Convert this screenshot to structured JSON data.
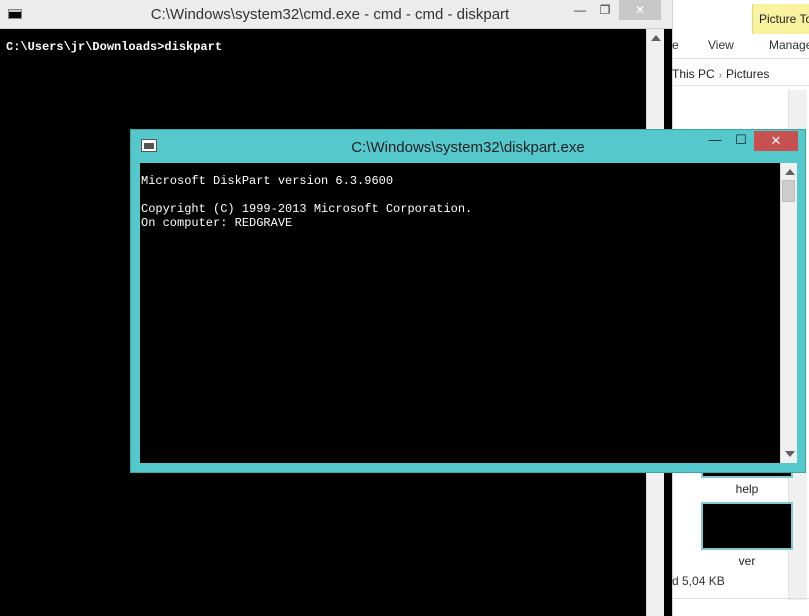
{
  "explorer": {
    "context_tab": "Picture To",
    "ribbon_tabs": [
      "e",
      "View",
      "Manage"
    ],
    "breadcrumb": [
      "This PC",
      "Pictures"
    ],
    "thumbnails": [
      {
        "label": "help"
      },
      {
        "label": "ver"
      }
    ],
    "status_text": "d  5,04 KB",
    "accent_color": "#7ec9d2"
  },
  "cmd_window": {
    "title": "C:\\Windows\\system32\\cmd.exe - cmd - cmd - diskpart",
    "minimize_icon": "—",
    "maximize_icon": "❐",
    "close_icon": "✕",
    "console_text": "C:\\Users\\jr\\Downloads>diskpart"
  },
  "diskpart_window": {
    "title": "C:\\Windows\\system32\\diskpart.exe",
    "minimize_icon": "—",
    "maximize_icon": "☐",
    "close_icon": "✕",
    "console_lines": [
      "Microsoft DiskPart version 6.3.9600",
      "",
      "Copyright (C) 1999-2013 Microsoft Corporation.",
      "On computer: REDGRAVE"
    ],
    "frame_color": "#55c8cc",
    "close_color": "#c75050"
  }
}
